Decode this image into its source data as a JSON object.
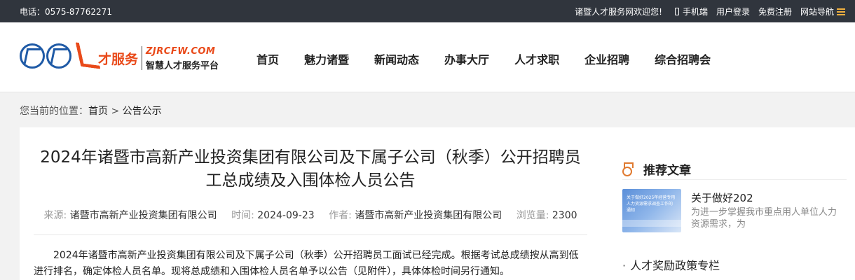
{
  "topbar": {
    "phone": "电话：0575-87762271",
    "welcome": "诸暨人才服务网欢迎您!",
    "mobile": "手机端",
    "login": "用户登录",
    "register": "免费注册",
    "site_nav": "网站导航"
  },
  "logo": {
    "mark_text": "诸暨",
    "ren": "人",
    "cfw": "才服务",
    "domain": "ZJRCFW.COM",
    "slogan": "智慧人才服务平台"
  },
  "nav": [
    "首页",
    "魅力诸暨",
    "新闻动态",
    "办事大厅",
    "人才求职",
    "企业招聘",
    "综合招聘会"
  ],
  "breadcrumb": {
    "prefix": "您当前的位置：",
    "home": "首页",
    "separator": ">",
    "current": "公告公示"
  },
  "article": {
    "title": "2024年诸暨市高新产业投资集团有限公司及下属子公司（秋季）公开招聘员工总成绩及入围体检人员公告",
    "source_label": "来源:",
    "source": "诸暨市高新产业投资集团有限公司",
    "time_label": "时间:",
    "time": "2024-09-23",
    "author_label": "作者:",
    "author": "诸暨市高新产业投资集团有限公司",
    "views_label": "浏览量:",
    "views": "2300",
    "body": "2024年诸暨市高新产业投资集团有限公司及下属子公司（秋季）公开招聘员工面试已经完成。根据考试总成绩按从高到低进行排名，确定体检人员名单。现将总成绩和入围体检人员名单予以公告（见附件），具体体检时间另行通知。"
  },
  "sidebar": {
    "title": "推荐文章",
    "featured": {
      "thumb_caption": "关于做好2025年经营专用人力资源需求调查工作的通知",
      "title": "关于做好202",
      "desc": "为进一步掌握我市重点用人单位人力资源需求，为"
    },
    "link_dot": "·",
    "link": "人才奖励政策专栏"
  },
  "colors": {
    "topbar_bg": "#30353d",
    "brand_orange": "#e94a1a",
    "brand_blue": "#1f5aa6"
  },
  "icons": [
    "mobile-icon",
    "menu-icon",
    "medal-icon"
  ]
}
